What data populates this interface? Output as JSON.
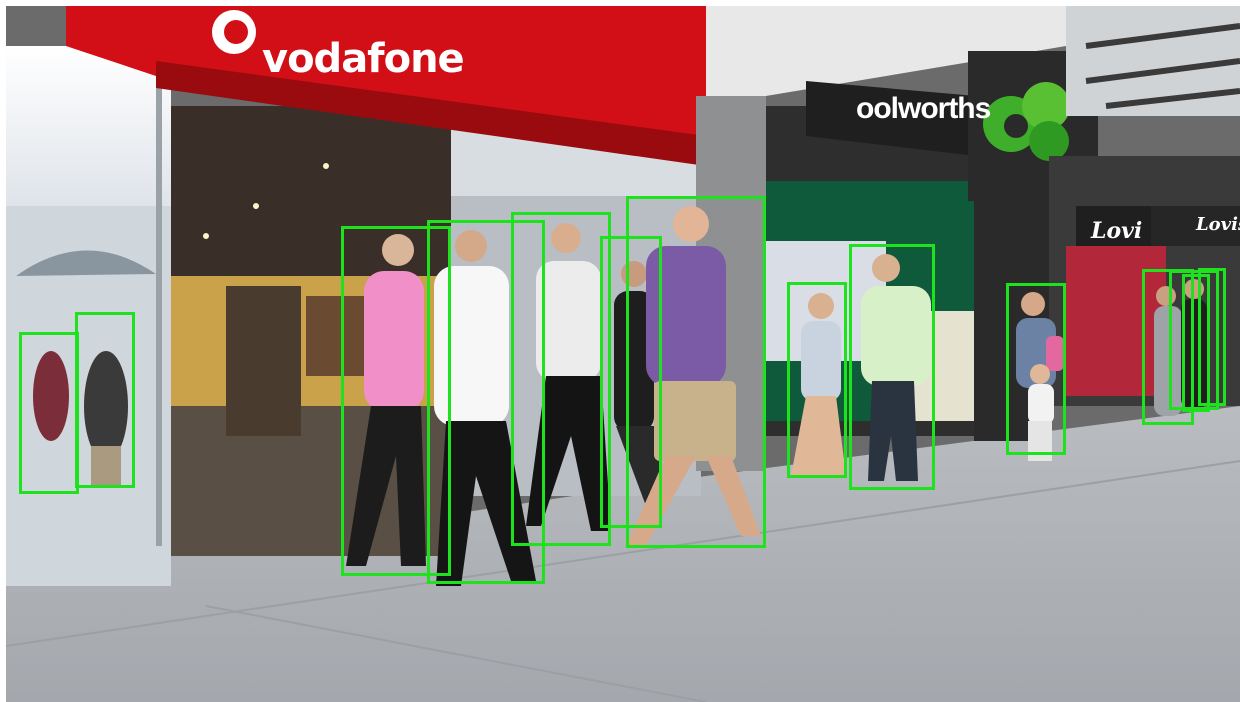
{
  "image": {
    "description_tag": "street scene with pedestrian detection boxes",
    "box_color": "#1fe21f"
  },
  "signs": {
    "vodafone": "vodafone",
    "woolworths": "oolworths",
    "lovisa_1": "Lovi",
    "lovisa_2": "Lovisa"
  },
  "detections": {
    "count": 14,
    "label": "person"
  }
}
